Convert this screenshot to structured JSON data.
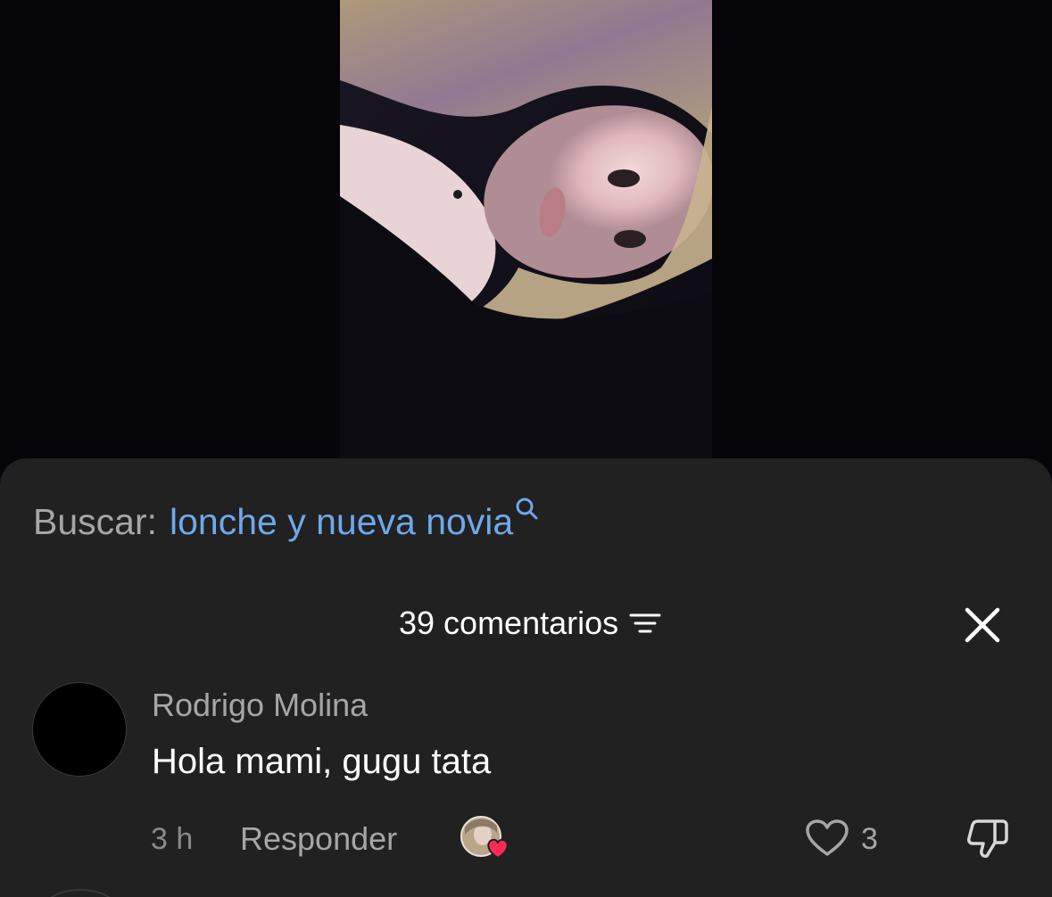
{
  "search": {
    "prefix": "Buscar:",
    "term": "lonche y nueva novia",
    "icon": "search-icon"
  },
  "comments_header": {
    "count_label": "39 comentarios",
    "filter_icon": "filter-icon",
    "close_icon": "close-icon"
  },
  "comment": {
    "author": "Rodrigo Molina",
    "text": "Hola mami, gugu tata",
    "timestamp": "3 h",
    "reply_label": "Responder",
    "creator_liked_icon": "creator-liked-avatar-icon",
    "like_count": "3",
    "like_icon": "heart-icon",
    "dislike_icon": "thumbs-down-icon"
  },
  "colors": {
    "background": "#05050a",
    "sheet": "#212121",
    "search_term": "#6fa8ea",
    "muted_text": "#a6a6a6",
    "primary_text": "#ffffff",
    "heart_badge": "#fe2c55"
  }
}
